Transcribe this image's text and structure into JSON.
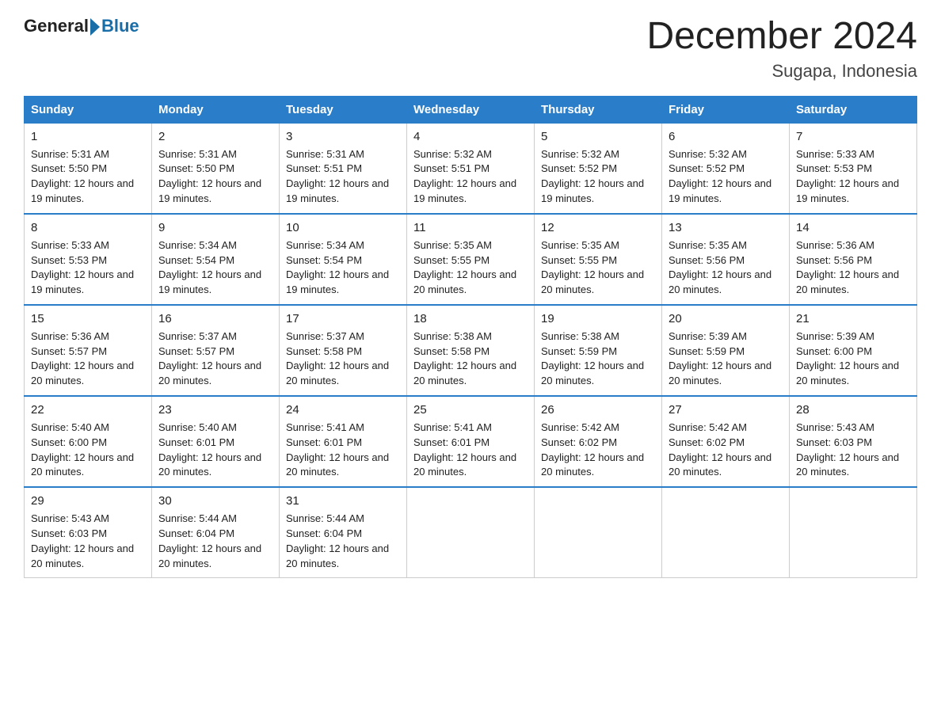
{
  "logo": {
    "text_general": "General",
    "text_blue": "Blue"
  },
  "title": "December 2024",
  "subtitle": "Sugapa, Indonesia",
  "days_of_week": [
    "Sunday",
    "Monday",
    "Tuesday",
    "Wednesday",
    "Thursday",
    "Friday",
    "Saturday"
  ],
  "weeks": [
    [
      {
        "day": 1,
        "sunrise": "5:31 AM",
        "sunset": "5:50 PM",
        "daylight": "12 hours and 19 minutes."
      },
      {
        "day": 2,
        "sunrise": "5:31 AM",
        "sunset": "5:50 PM",
        "daylight": "12 hours and 19 minutes."
      },
      {
        "day": 3,
        "sunrise": "5:31 AM",
        "sunset": "5:51 PM",
        "daylight": "12 hours and 19 minutes."
      },
      {
        "day": 4,
        "sunrise": "5:32 AM",
        "sunset": "5:51 PM",
        "daylight": "12 hours and 19 minutes."
      },
      {
        "day": 5,
        "sunrise": "5:32 AM",
        "sunset": "5:52 PM",
        "daylight": "12 hours and 19 minutes."
      },
      {
        "day": 6,
        "sunrise": "5:32 AM",
        "sunset": "5:52 PM",
        "daylight": "12 hours and 19 minutes."
      },
      {
        "day": 7,
        "sunrise": "5:33 AM",
        "sunset": "5:53 PM",
        "daylight": "12 hours and 19 minutes."
      }
    ],
    [
      {
        "day": 8,
        "sunrise": "5:33 AM",
        "sunset": "5:53 PM",
        "daylight": "12 hours and 19 minutes."
      },
      {
        "day": 9,
        "sunrise": "5:34 AM",
        "sunset": "5:54 PM",
        "daylight": "12 hours and 19 minutes."
      },
      {
        "day": 10,
        "sunrise": "5:34 AM",
        "sunset": "5:54 PM",
        "daylight": "12 hours and 19 minutes."
      },
      {
        "day": 11,
        "sunrise": "5:35 AM",
        "sunset": "5:55 PM",
        "daylight": "12 hours and 20 minutes."
      },
      {
        "day": 12,
        "sunrise": "5:35 AM",
        "sunset": "5:55 PM",
        "daylight": "12 hours and 20 minutes."
      },
      {
        "day": 13,
        "sunrise": "5:35 AM",
        "sunset": "5:56 PM",
        "daylight": "12 hours and 20 minutes."
      },
      {
        "day": 14,
        "sunrise": "5:36 AM",
        "sunset": "5:56 PM",
        "daylight": "12 hours and 20 minutes."
      }
    ],
    [
      {
        "day": 15,
        "sunrise": "5:36 AM",
        "sunset": "5:57 PM",
        "daylight": "12 hours and 20 minutes."
      },
      {
        "day": 16,
        "sunrise": "5:37 AM",
        "sunset": "5:57 PM",
        "daylight": "12 hours and 20 minutes."
      },
      {
        "day": 17,
        "sunrise": "5:37 AM",
        "sunset": "5:58 PM",
        "daylight": "12 hours and 20 minutes."
      },
      {
        "day": 18,
        "sunrise": "5:38 AM",
        "sunset": "5:58 PM",
        "daylight": "12 hours and 20 minutes."
      },
      {
        "day": 19,
        "sunrise": "5:38 AM",
        "sunset": "5:59 PM",
        "daylight": "12 hours and 20 minutes."
      },
      {
        "day": 20,
        "sunrise": "5:39 AM",
        "sunset": "5:59 PM",
        "daylight": "12 hours and 20 minutes."
      },
      {
        "day": 21,
        "sunrise": "5:39 AM",
        "sunset": "6:00 PM",
        "daylight": "12 hours and 20 minutes."
      }
    ],
    [
      {
        "day": 22,
        "sunrise": "5:40 AM",
        "sunset": "6:00 PM",
        "daylight": "12 hours and 20 minutes."
      },
      {
        "day": 23,
        "sunrise": "5:40 AM",
        "sunset": "6:01 PM",
        "daylight": "12 hours and 20 minutes."
      },
      {
        "day": 24,
        "sunrise": "5:41 AM",
        "sunset": "6:01 PM",
        "daylight": "12 hours and 20 minutes."
      },
      {
        "day": 25,
        "sunrise": "5:41 AM",
        "sunset": "6:01 PM",
        "daylight": "12 hours and 20 minutes."
      },
      {
        "day": 26,
        "sunrise": "5:42 AM",
        "sunset": "6:02 PM",
        "daylight": "12 hours and 20 minutes."
      },
      {
        "day": 27,
        "sunrise": "5:42 AM",
        "sunset": "6:02 PM",
        "daylight": "12 hours and 20 minutes."
      },
      {
        "day": 28,
        "sunrise": "5:43 AM",
        "sunset": "6:03 PM",
        "daylight": "12 hours and 20 minutes."
      }
    ],
    [
      {
        "day": 29,
        "sunrise": "5:43 AM",
        "sunset": "6:03 PM",
        "daylight": "12 hours and 20 minutes."
      },
      {
        "day": 30,
        "sunrise": "5:44 AM",
        "sunset": "6:04 PM",
        "daylight": "12 hours and 20 minutes."
      },
      {
        "day": 31,
        "sunrise": "5:44 AM",
        "sunset": "6:04 PM",
        "daylight": "12 hours and 20 minutes."
      },
      null,
      null,
      null,
      null
    ]
  ]
}
